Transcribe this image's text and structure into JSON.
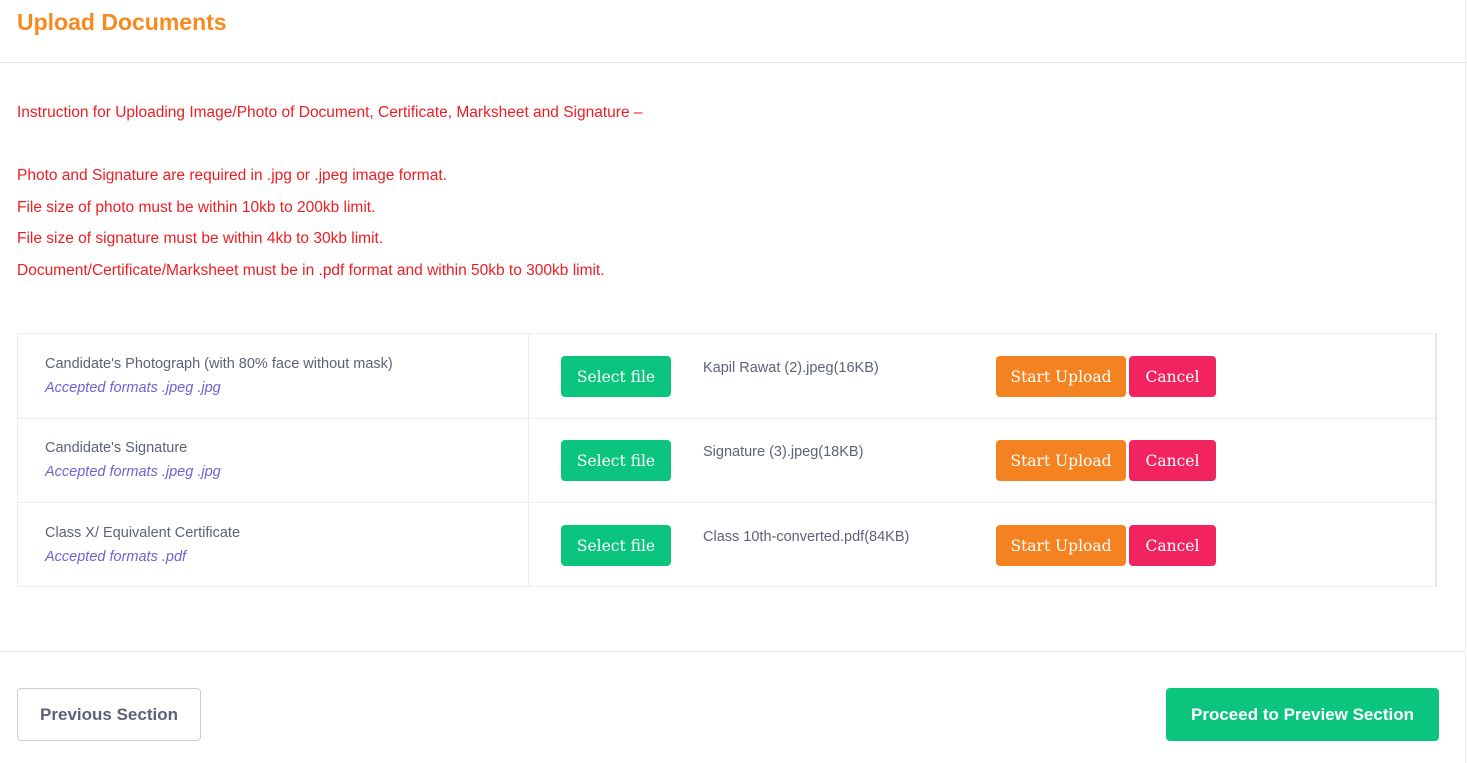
{
  "header": {
    "title": "Upload Documents"
  },
  "instructions": {
    "heading": "Instruction for Uploading Image/Photo of Document, Certificate, Marksheet and Signature –",
    "lines": [
      "Photo and Signature are required in .jpg or .jpeg image format.",
      "File size of photo must be within 10kb to 200kb limit.",
      "File size of signature must be within 4kb to 30kb limit.",
      "Document/Certificate/Marksheet must be in .pdf format and within 50kb to 300kb limit."
    ]
  },
  "uploads": [
    {
      "label": "Candidate's Photograph (with 80% face without mask)",
      "formats": "Accepted formats .jpeg .jpg",
      "select_label": "Select file",
      "file_name": "Kapil Rawat (2).jpeg(16KB)",
      "start_label": "Start Upload",
      "cancel_label": "Cancel"
    },
    {
      "label": "Candidate's Signature",
      "formats": "Accepted formats .jpeg .jpg",
      "select_label": "Select file",
      "file_name": "Signature (3).jpeg(18KB)",
      "start_label": "Start Upload",
      "cancel_label": "Cancel"
    },
    {
      "label": "Class X/ Equivalent Certificate",
      "formats": "Accepted formats .pdf",
      "select_label": "Select file",
      "file_name": "Class 10th-converted.pdf(84KB)",
      "start_label": "Start Upload",
      "cancel_label": "Cancel"
    }
  ],
  "footer": {
    "previous_label": "Previous Section",
    "next_label": "Proceed to Preview Section"
  },
  "colors": {
    "title": "#f7891f",
    "instruction_text": "#ee1d23",
    "select_button": "#0bc57e",
    "start_upload_button": "#f58220",
    "cancel_button": "#f2245f",
    "formats_text": "#6c63d6",
    "proceed_button": "#0bc57e"
  }
}
